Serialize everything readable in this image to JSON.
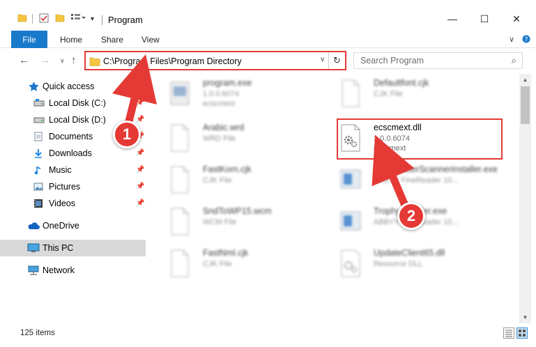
{
  "window": {
    "title": "Program",
    "controls": {
      "minimize": "—",
      "maximize": "☐",
      "close": "✕"
    }
  },
  "ribbon": {
    "file": "File",
    "tabs": [
      "Home",
      "Share",
      "View"
    ]
  },
  "nav": {
    "address": "C:\\Program Files\\Program Directory",
    "search_placeholder": "Search Program"
  },
  "sidebar": {
    "items": [
      {
        "label": "Quick access",
        "icon": "star-icon"
      },
      {
        "label": "Local Disk (C:)",
        "icon": "drive-icon",
        "pinned": true
      },
      {
        "label": "Local Disk (D:)",
        "icon": "drive-icon",
        "pinned": true
      },
      {
        "label": "Documents",
        "icon": "documents-icon",
        "pinned": true
      },
      {
        "label": "Downloads",
        "icon": "downloads-icon",
        "pinned": true
      },
      {
        "label": "Music",
        "icon": "music-icon",
        "pinned": true
      },
      {
        "label": "Pictures",
        "icon": "pictures-icon",
        "pinned": true
      },
      {
        "label": "Videos",
        "icon": "videos-icon",
        "pinned": true
      },
      {
        "label": "OneDrive",
        "icon": "cloud-icon"
      },
      {
        "label": "This PC",
        "icon": "pc-icon",
        "selected": true
      },
      {
        "label": "Network",
        "icon": "network-icon"
      }
    ]
  },
  "files": [
    {
      "name": "program.exe",
      "line1": "1.0.0.6074",
      "line2": "ecscmext",
      "icon": "exe-icon",
      "blurred": true
    },
    {
      "name": "Defaultfont.cjk",
      "line1": "CJK File",
      "line2": "",
      "icon": "file-icon",
      "blurred": true
    },
    {
      "name": "Arabic.wrd",
      "line1": "WRD File",
      "line2": "",
      "icon": "file-icon",
      "blurred": true
    },
    {
      "name": "ecscmext.dll",
      "line1": "1.0.0.6074",
      "line2": "ecscmext",
      "icon": "dll-gear-icon",
      "blurred": false
    },
    {
      "name": "FastKorn.cjk",
      "line1": "CJK File",
      "line2": "",
      "icon": "file-icon",
      "blurred": true
    },
    {
      "name": "FineReaderScannerinstaller.exe",
      "line1": "ABBYY FineReader 10...",
      "line2": "",
      "icon": "installer-icon",
      "blurred": true
    },
    {
      "name": "SndToWP15.wcm",
      "line1": "WCM File",
      "line2": "",
      "icon": "file-icon",
      "blurred": true
    },
    {
      "name": "TrophyInstaller.exe",
      "line1": "ABBYY FineReader 10...",
      "line2": "",
      "icon": "installer-icon",
      "blurred": true
    },
    {
      "name": "FastNml.cjk",
      "line1": "CJK File",
      "line2": "",
      "icon": "file-icon",
      "blurred": true
    },
    {
      "name": "UpdateClient65.dll",
      "line1": "Resource DLL",
      "line2": "",
      "icon": "dll-gear-icon",
      "blurred": true
    }
  ],
  "status": {
    "items": "125 items"
  },
  "annotations": {
    "step1": "1",
    "step2": "2"
  },
  "colors": {
    "accent": "#1979ca",
    "annotation": "#e53935",
    "selected": "#d9d9d9"
  }
}
